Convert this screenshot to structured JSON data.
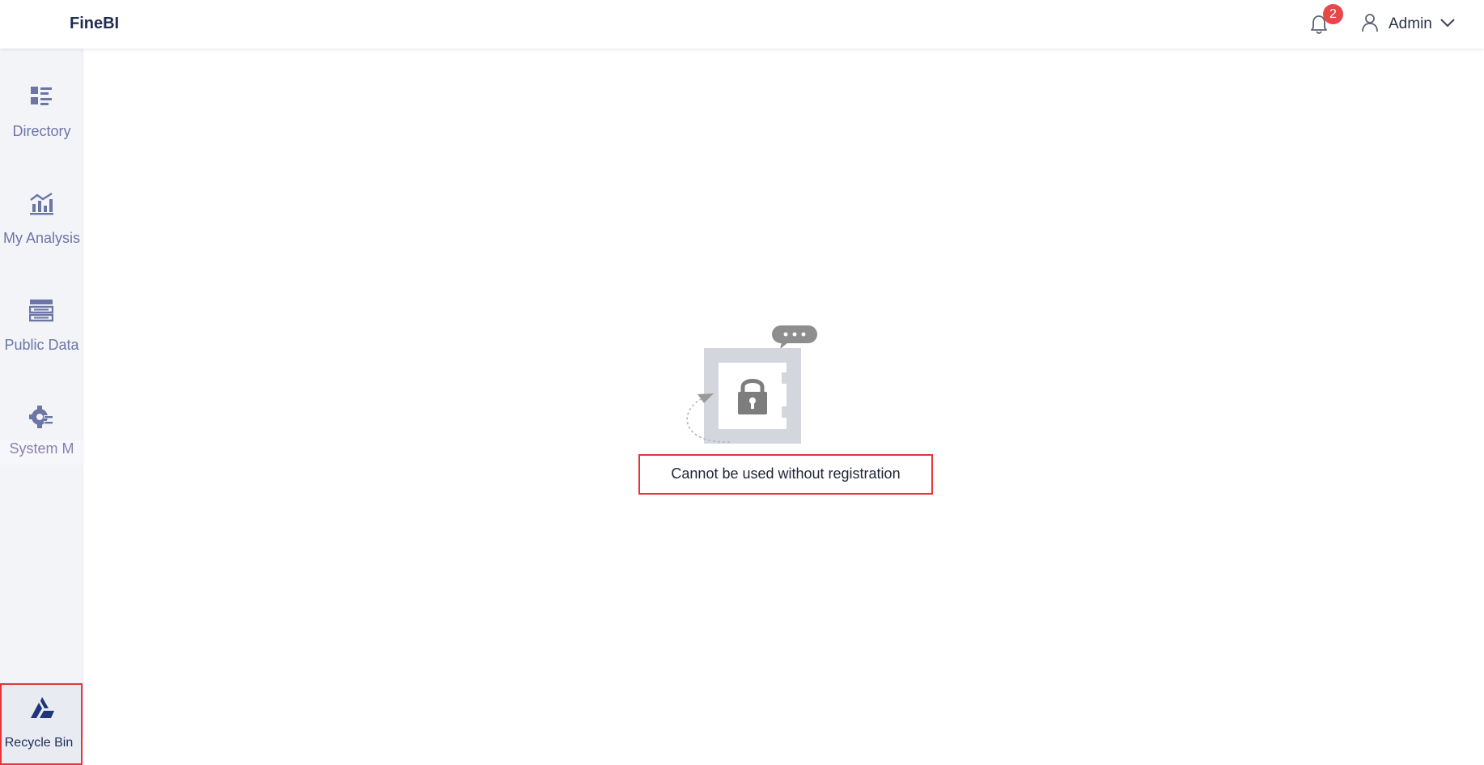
{
  "header": {
    "brand": "FineBI",
    "notification_count": "2",
    "user_name": "Admin"
  },
  "sidebar": {
    "items": [
      {
        "label": "Directory",
        "icon": "directory-icon"
      },
      {
        "label": "My Analysis",
        "icon": "analysis-chart-icon"
      },
      {
        "label": "Public Data",
        "icon": "public-data-icon"
      },
      {
        "label": "System M",
        "icon": "system-gear-icon"
      }
    ],
    "recycle_bin": {
      "label": "Recycle Bin",
      "icon": "recycle-bin-icon"
    }
  },
  "main": {
    "message": "Cannot be used without registration",
    "illustration": "locked-safe-icon"
  },
  "colors": {
    "accent": "#6b76a6",
    "brand_text": "#1f2d54",
    "badge": "#e8474a",
    "highlight_border": "#e8333a",
    "sidebar_bg": "#f3f4f8"
  }
}
